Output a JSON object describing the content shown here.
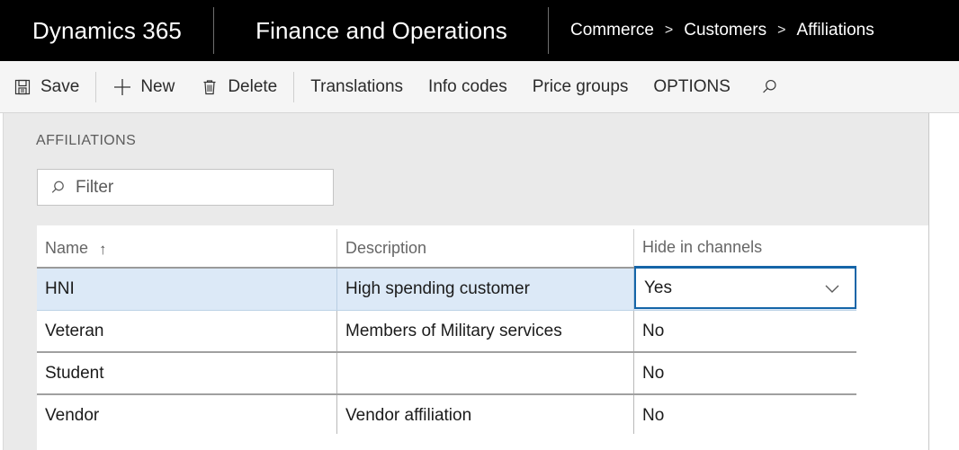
{
  "topbar": {
    "brand": "Dynamics 365",
    "product": "Finance and Operations",
    "breadcrumb": {
      "separator": ">",
      "items": [
        "Commerce",
        "Customers",
        "Affiliations"
      ]
    },
    "background_color": "#000000",
    "text_color": "#ffffff"
  },
  "toolbar": {
    "items": [
      {
        "label": "Save",
        "icon": "save-icon"
      },
      {
        "label": "New",
        "icon": "plus-icon"
      },
      {
        "label": "Delete",
        "icon": "trash-icon"
      },
      {
        "label": "Translations",
        "icon": ""
      },
      {
        "label": "Info codes",
        "icon": ""
      },
      {
        "label": "Price groups",
        "icon": ""
      },
      {
        "label": "OPTIONS",
        "icon": ""
      }
    ],
    "search_icon": "search-icon",
    "background_color": "#f5f5f5"
  },
  "section": {
    "caption": "AFFILIATIONS"
  },
  "filter": {
    "icon": "search-icon",
    "value": "",
    "placeholder": "Filter"
  },
  "grid": {
    "columns": [
      {
        "key": "name",
        "label": "Name",
        "sort": "ascending",
        "sort_glyph": "↑"
      },
      {
        "key": "description",
        "label": "Description",
        "sort": "none",
        "sort_glyph": ""
      },
      {
        "key": "hide_in_channels",
        "label": "Hide in channels",
        "sort": "none",
        "sort_glyph": ""
      }
    ],
    "rows": [
      {
        "name": "HNI",
        "description": "High spending customer",
        "hide_in_channels": "Yes",
        "selected": true,
        "editing_cell": "hide_in_channels"
      },
      {
        "name": "Veteran",
        "description": "Members of Military services",
        "hide_in_channels": "No",
        "selected": false,
        "editing_cell": ""
      },
      {
        "name": "Student",
        "description": "",
        "hide_in_channels": "No",
        "selected": false,
        "editing_cell": ""
      },
      {
        "name": "Vendor",
        "description": "Vendor affiliation",
        "hide_in_channels": "No",
        "selected": false,
        "editing_cell": ""
      }
    ],
    "dropdown_chevron": "chevron-down-icon",
    "selected_row_color": "#dce9f7",
    "active_cell_border_color": "#1565a8"
  }
}
